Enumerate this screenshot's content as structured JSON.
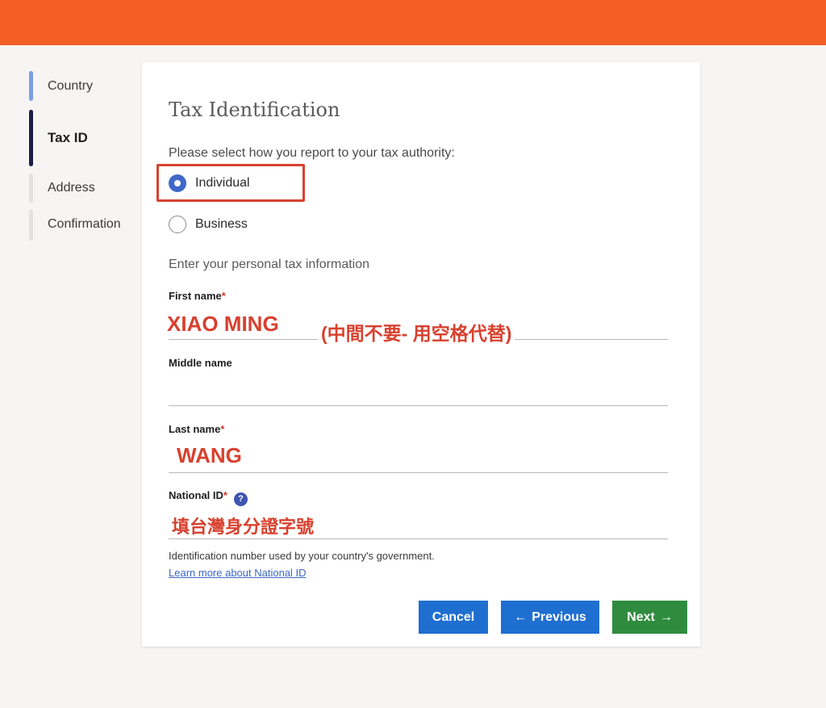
{
  "stepper": {
    "steps": [
      {
        "label": "Country",
        "state": "done"
      },
      {
        "label": "Tax ID",
        "state": "active"
      },
      {
        "label": "Address",
        "state": "pending"
      },
      {
        "label": "Confirmation",
        "state": "pending"
      }
    ]
  },
  "form": {
    "title": "Tax Identification",
    "question": "Please select how you report to your tax authority:",
    "options": [
      {
        "label": "Individual",
        "checked": true
      },
      {
        "label": "Business",
        "checked": false
      }
    ],
    "section_label": "Enter your personal tax information",
    "required_mark": "*",
    "fields": {
      "first_name": {
        "label": "First name"
      },
      "middle_name": {
        "label": "Middle name"
      },
      "last_name": {
        "label": "Last name"
      },
      "national_id": {
        "label": "National ID"
      }
    },
    "help_icon_glyph": "?",
    "help_text": "Identification number used by your country's government.",
    "learn_more": "Learn more about National ID"
  },
  "annotations": {
    "first_name_value": "XIAO MING",
    "first_name_note": "(中間不要- 用空格代替)",
    "last_name_value": "WANG",
    "national_id_note": "填台灣身分證字號"
  },
  "buttons": {
    "cancel": "Cancel",
    "previous": "Previous",
    "previous_arrow": "←",
    "next": "Next",
    "next_arrow": "→"
  },
  "colors": {
    "brand_orange": "#f35f24",
    "primary_blue": "#1f6fd1",
    "next_green": "#2f8c3e",
    "annotation_red": "#d8412f"
  }
}
